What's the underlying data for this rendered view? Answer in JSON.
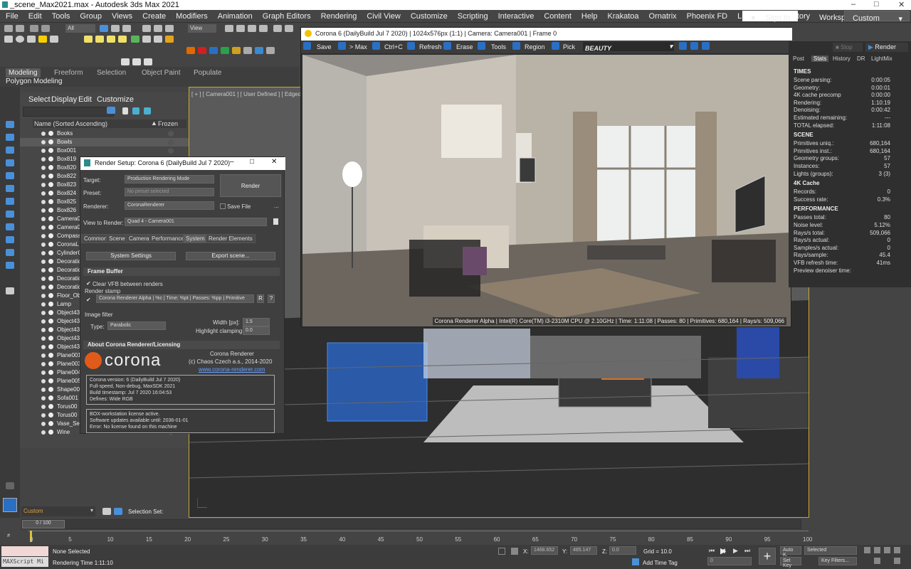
{
  "window": {
    "title": "_scene_Max2021.max - Autodesk 3ds Max 2021"
  },
  "menu": [
    "File",
    "Edit",
    "Tools",
    "Group",
    "Views",
    "Create",
    "Modifiers",
    "Animation",
    "Graph Editors",
    "Rendering",
    "Civil View",
    "Customize",
    "Scripting",
    "Interactive",
    "Content",
    "Help",
    "Krakatoa",
    "Ornatrix",
    "Phoenix FD",
    "Lucid",
    "PlantFactory"
  ],
  "signin": "Sign In",
  "workspaces": {
    "label": "Workspaces:",
    "value": "Custom"
  },
  "toolbar": {
    "selection_filter": "All",
    "view": "View"
  },
  "ribbon": {
    "tabs": [
      "Modeling",
      "Freeform",
      "Selection",
      "Object Paint",
      "Populate"
    ],
    "sub": "Polygon Modeling"
  },
  "scene_explorer": {
    "menu": [
      "Select",
      "Display",
      "Edit",
      "Customize"
    ],
    "header_name": "Name (Sorted Ascending)",
    "header_frozen": "Frozen",
    "items": [
      "Books",
      "Bowls",
      "Box001",
      "Box819",
      "Box820",
      "Box822",
      "Box823",
      "Box824",
      "Box825",
      "Box826",
      "Camera0",
      "Camera0",
      "Compass",
      "CoronaL",
      "CylinderC",
      "Decoratic",
      "Decoratic",
      "Decoratic",
      "Decoratic",
      "Floor_Ob",
      "Lamp",
      "Object43",
      "Object43",
      "Object43",
      "Object43",
      "Object43",
      "Plane001",
      "Plane003",
      "Plane004",
      "Plane005",
      "Shape00",
      "Sofa001",
      "Torus00",
      "Torus00",
      "Vase_Se",
      "Wine"
    ],
    "selection_set_value": "Custom",
    "selection_set_label": "Selection Set:"
  },
  "render_setup": {
    "title": "Render Setup: Corona 6 (DailyBuild Jul  7 2020)",
    "target_label": "Target:",
    "target": "Production Rendering Mode",
    "preset_label": "Preset:",
    "preset": "No preset selected",
    "renderer_label": "Renderer:",
    "renderer": "CoronaRenderer",
    "save_file": "Save File",
    "view_label": "View to Render:",
    "view": "Quad 4 - Camera001",
    "render_button": "Render",
    "tabs": [
      "Common",
      "Scene",
      "Camera",
      "Performance",
      "System",
      "Render Elements"
    ],
    "system_settings": "System Settings",
    "export_scene": "Export scene...",
    "frame_buffer": "Frame Buffer",
    "clear_vfb": "Clear VFB between renders",
    "render_stamp_label": "Render stamp",
    "render_stamp": "Corona Renderer Alpha | %c | Time: %pt | Passes: %pp | Primitive",
    "image_filter": "Image filter",
    "type_label": "Type:",
    "type": "Parabolic",
    "width_label": "Width [px]:",
    "width": "1.5",
    "clamp_label": "Highlight clamping:",
    "clamp": "0.0",
    "about": "About Corona Renderer/Licensing",
    "logo_text": "corona",
    "product": "Corona Renderer",
    "copyright": "(c) Chaos Czech a.s., 2014-2020",
    "link": "www.corona-renderer.com",
    "version_lines": [
      "Corona version: 6 (DailyBuild Jul  7 2020)",
      "Full-speed, Non-debug, MaxSDK 2021",
      "Build timestamp: Jul  7 2020 16:04:53",
      "Defines: Wide RGB"
    ],
    "license_lines": [
      "BOX-workstation license active.",
      "Software updates available until: 2036-01-01",
      "Error: No license found on this machine"
    ]
  },
  "vfb": {
    "title": "Corona 6 (DailyBuild Jul  7 2020) | 1024x576px (1:1) | Camera: Camera001 | Frame 0",
    "tools": [
      "Save",
      "> Max",
      "Ctrl+C",
      "Refresh",
      "Erase",
      "Tools",
      "Region",
      "Pick"
    ],
    "channel": "BEAUTY",
    "stop": "Stop",
    "render": "Render",
    "status": "Corona Renderer Alpha | Intel(R) Core(TM) i3-2310M CPU @ 2.10GHz | Time: 1:11:08 | Passes: 80 | Primitives: 680,164 | Rays/s: 509,066"
  },
  "stats": {
    "tabs": [
      "Post",
      "Stats",
      "History",
      "DR",
      "LightMix"
    ],
    "sections": [
      {
        "title": "TIMES",
        "rows": [
          [
            "Scene parsing:",
            "0:00:05"
          ],
          [
            "Geometry:",
            "0:00:01"
          ],
          [
            "4K cache precomp",
            "0:00:00"
          ],
          [
            "Rendering:",
            "1:10:19"
          ],
          [
            "Denoising:",
            "0:00:42"
          ],
          [
            "Estimated remaining:",
            "---"
          ],
          [
            "TOTAL elapsed:",
            "1:11:08"
          ]
        ]
      },
      {
        "title": "SCENE",
        "rows": [
          [
            "Primitives uniq.:",
            "680,164"
          ],
          [
            "Primitives inst.:",
            "680,164"
          ],
          [
            "Geometry groups:",
            "57"
          ],
          [
            "Instances:",
            "57"
          ],
          [
            "Lights (groups):",
            "3 (3)"
          ]
        ]
      },
      {
        "title": "4K Cache",
        "rows": [
          [
            "Records:",
            "0"
          ],
          [
            "Success rate:",
            "0.3%"
          ]
        ]
      },
      {
        "title": "PERFORMANCE",
        "rows": [
          [
            "Passes total:",
            "80"
          ],
          [
            "Noise level:",
            "5.12%"
          ],
          [
            "Rays/s total:",
            "509,066"
          ],
          [
            "Rays/s actual:",
            "0"
          ],
          [
            "Samples/s actual:",
            "0"
          ],
          [
            "Rays/sample:",
            "45.4"
          ],
          [
            "VFB refresh time:",
            "41ms"
          ],
          [
            "Preview denoiser time:",
            ""
          ]
        ]
      }
    ]
  },
  "viewport": {
    "label": "[ + ] [ Camera001 ] [ User Defined ] [ Edged Face"
  },
  "timeline": {
    "frame": "0 / 100",
    "ticks": [
      "0",
      "5",
      "10",
      "15",
      "20",
      "25",
      "30",
      "35",
      "40",
      "45",
      "50",
      "55",
      "60",
      "65",
      "70",
      "75",
      "80",
      "85",
      "90",
      "95",
      "100"
    ]
  },
  "status": {
    "script": "MAXScript Mi",
    "selection": "None Selected",
    "render_time": "Rendering Time  1:11:10",
    "x_label": "X:",
    "x": "1468.652",
    "y_label": "Y:",
    "y": "485.147",
    "z_label": "Z:",
    "z": "0.0",
    "grid": "Grid = 10.0",
    "add_time_tag": "Add Time Tag",
    "auto_key": "Auto K.",
    "set_key": "Set Key",
    "selected": "Selected",
    "key_filters": "Key Filters...",
    "frame": "0"
  }
}
